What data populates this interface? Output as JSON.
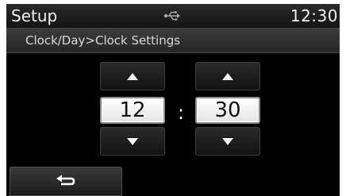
{
  "header": {
    "title": "Setup",
    "usb_icon": "usb-icon",
    "clock": "12:30"
  },
  "breadcrumb": "Clock/Day>Clock Settings",
  "time_setter": {
    "hour": "12",
    "minute": "30",
    "separator": ":",
    "up_icon": "triangle-up-icon",
    "down_icon": "triangle-down-icon"
  },
  "footer": {
    "back_icon": "back-arrow-icon"
  },
  "colors": {
    "screen_background": "#000000",
    "value_box_background": "#ffffff",
    "text": "#f0f0f0"
  }
}
